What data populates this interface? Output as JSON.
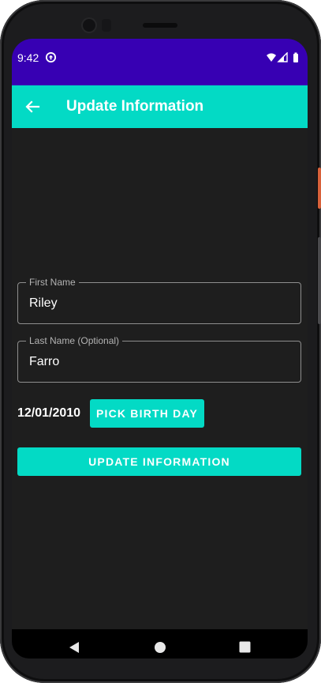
{
  "status_bar": {
    "time": "9:42",
    "app_icon": "sync-icon",
    "icons": [
      "wifi-icon",
      "signal-icon",
      "battery-icon"
    ],
    "color": "#3700b3"
  },
  "app_bar": {
    "title": "Update Information",
    "back_icon": "arrow-back-icon",
    "color": "#03dac5"
  },
  "form": {
    "first_name": {
      "label": "First Name",
      "value": "Riley"
    },
    "last_name": {
      "label": "Last Name (Optional)",
      "value": "Farro"
    },
    "birth_date": "12/01/2010",
    "pick_birth_day_label": "PICK BIRTH DAY",
    "update_button_label": "UPDATE INFORMATION"
  },
  "nav_bar": {
    "icons": [
      "back-triangle-icon",
      "home-circle-icon",
      "recents-square-icon"
    ]
  },
  "colors": {
    "accent": "#03dac5",
    "primary": "#3700b3",
    "background": "#1e1e1e",
    "text": "#ffffff"
  }
}
